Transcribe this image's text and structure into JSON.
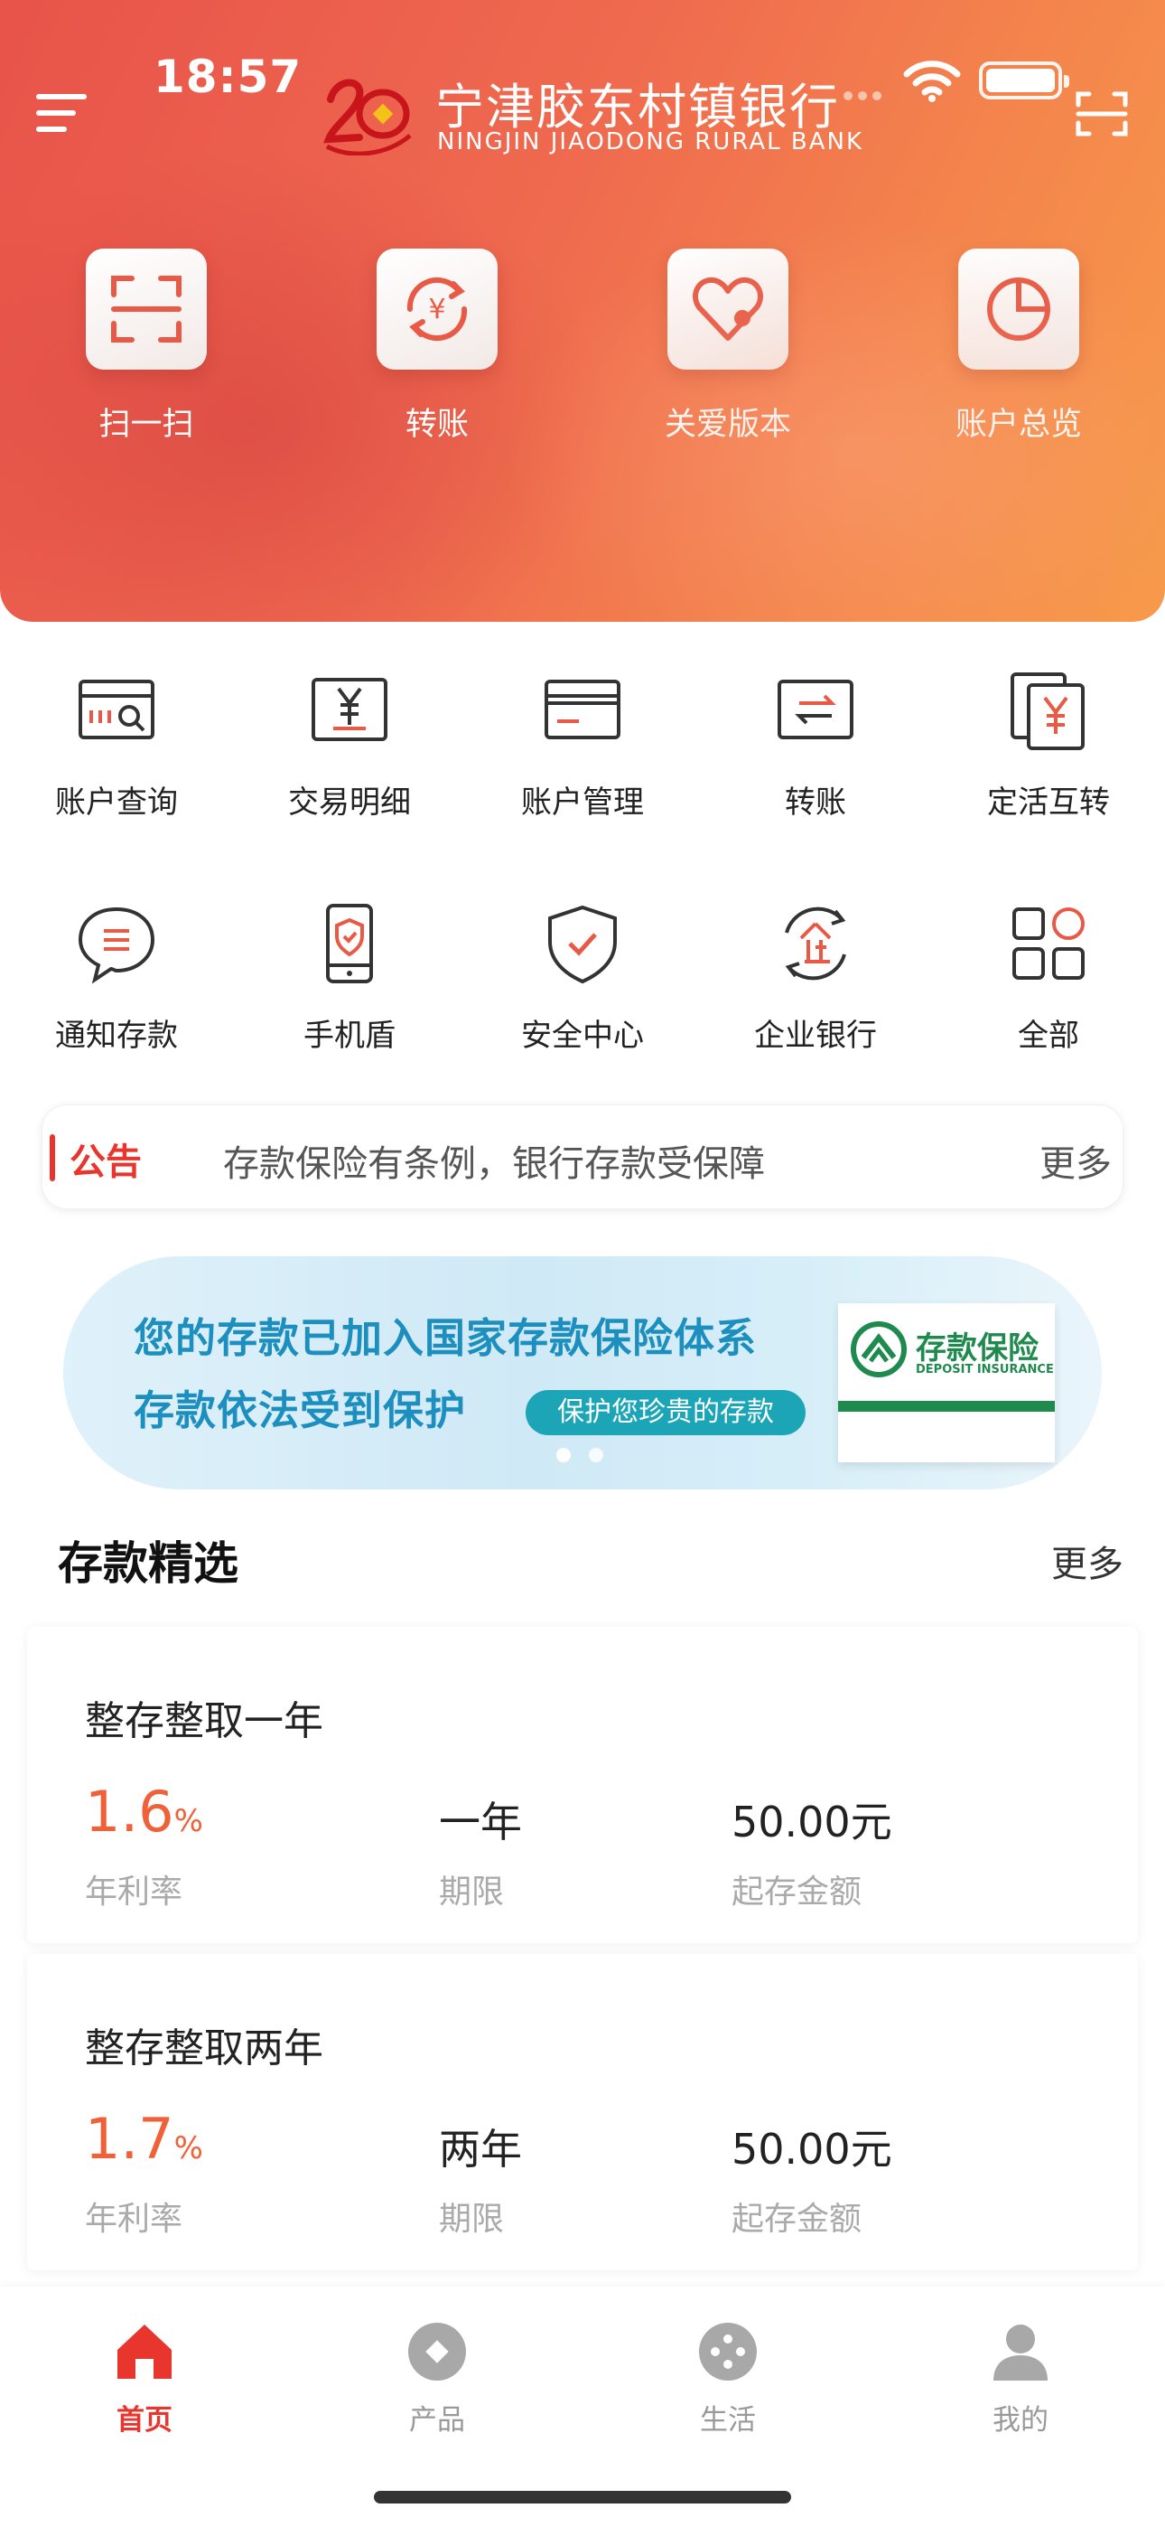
{
  "status": {
    "time": "18:57"
  },
  "header": {
    "bank_name": "宁津胶东村镇银行",
    "bank_name_en": "NINGJIN  JIAODONG  RURAL BANK",
    "logo_text": "20"
  },
  "quick_actions": [
    {
      "label": "扫一扫",
      "icon": "scan-icon"
    },
    {
      "label": "转账",
      "icon": "transfer-yuan-icon"
    },
    {
      "label": "关爱版本",
      "icon": "heart-care-icon"
    },
    {
      "label": "账户总览",
      "icon": "pie-chart-icon"
    }
  ],
  "services": [
    {
      "label": "账户查询",
      "icon": "account-search-icon"
    },
    {
      "label": "交易明细",
      "icon": "transaction-detail-icon"
    },
    {
      "label": "账户管理",
      "icon": "card-manage-icon"
    },
    {
      "label": "转账",
      "icon": "transfer-arrows-icon"
    },
    {
      "label": "定活互转",
      "icon": "deposit-convert-icon"
    },
    {
      "label": "通知存款",
      "icon": "notice-deposit-icon"
    },
    {
      "label": "手机盾",
      "icon": "phone-shield-icon"
    },
    {
      "label": "安全中心",
      "icon": "security-shield-icon"
    },
    {
      "label": "企业银行",
      "icon": "enterprise-bank-icon"
    },
    {
      "label": "全部",
      "icon": "all-grid-icon"
    }
  ],
  "notice": {
    "title": "公告",
    "text": "存款保险有条例，银行存款受保障",
    "more": "更多"
  },
  "banner": {
    "line1": "您的存款已加入国家存款保险体系",
    "line2": "存款依法受到保护",
    "pill": "保护您珍贵的存款",
    "card_title": "存款保险",
    "card_sub": "DEPOSIT INSURANCE"
  },
  "section": {
    "title": "存款精选",
    "more": "更多"
  },
  "products": [
    {
      "name": "整存整取一年",
      "rate": "1.6",
      "rate_unit": "%",
      "rate_label": "年利率",
      "period": "一年",
      "period_label": "期限",
      "amount": "50.00元",
      "amount_label": "起存金额"
    },
    {
      "name": "整存整取两年",
      "rate": "1.7",
      "rate_unit": "%",
      "rate_label": "年利率",
      "period": "两年",
      "period_label": "期限",
      "amount": "50.00元",
      "amount_label": "起存金额"
    }
  ],
  "tabs": [
    {
      "label": "首页",
      "icon": "home-icon",
      "active": true
    },
    {
      "label": "产品",
      "icon": "product-icon",
      "active": false
    },
    {
      "label": "生活",
      "icon": "life-icon",
      "active": false
    },
    {
      "label": "我的",
      "icon": "profile-icon",
      "active": false
    }
  ],
  "colors": {
    "accent": "#e8352e",
    "rate": "#f0613a",
    "banner_text": "#1c8fbf",
    "insurance_green": "#1e8a4e"
  }
}
